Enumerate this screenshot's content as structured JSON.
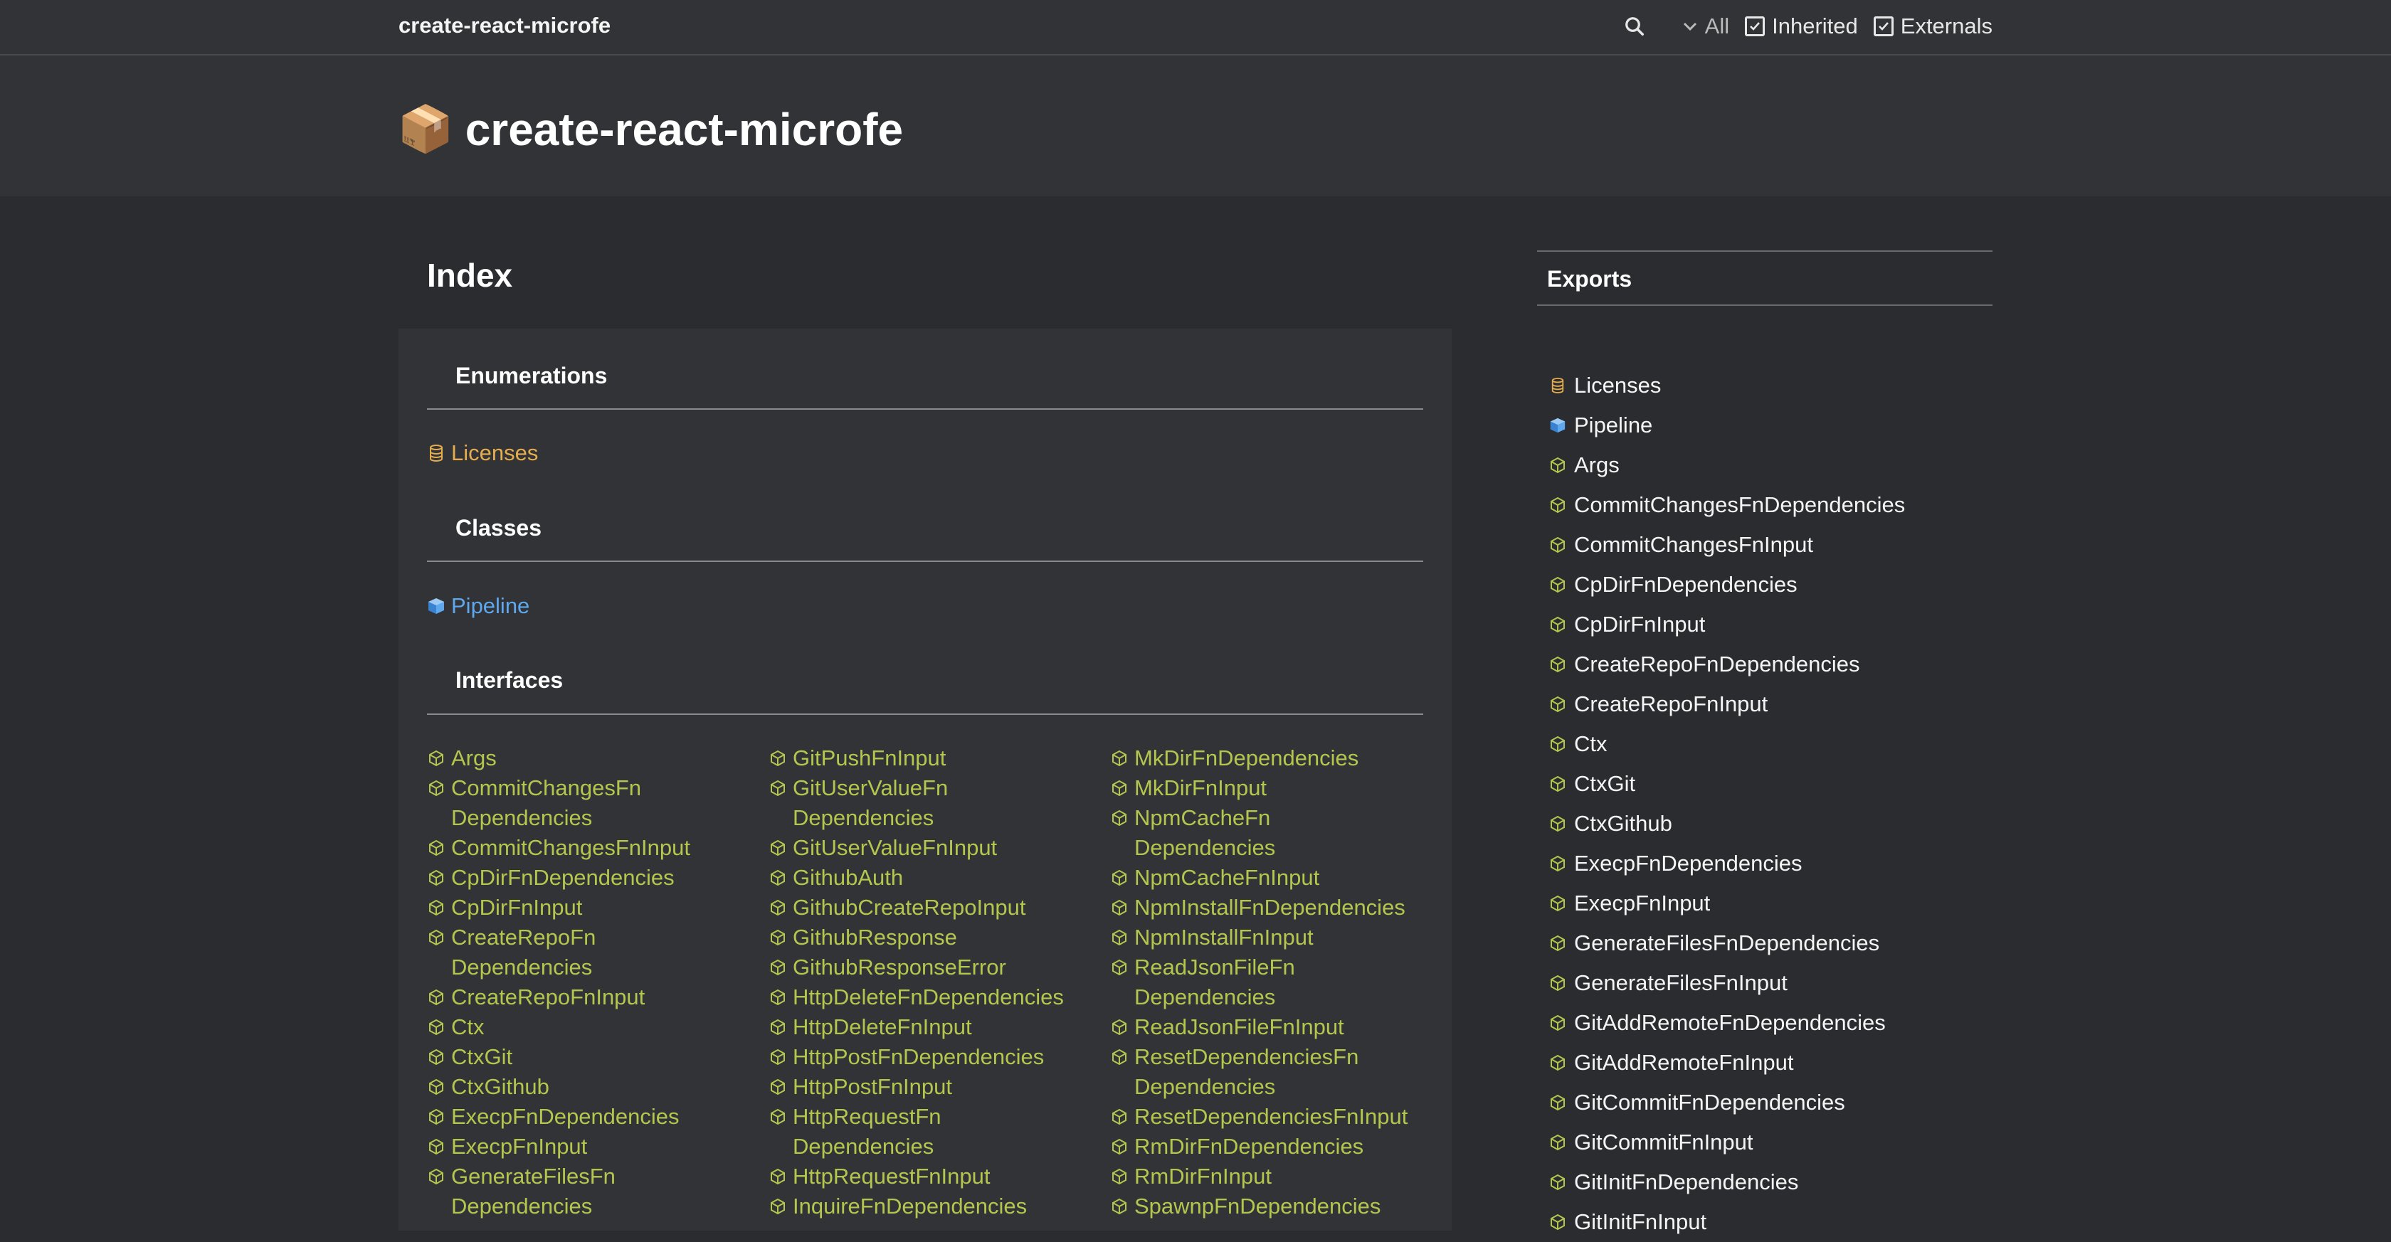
{
  "toolbar": {
    "brand": "create-react-microfe",
    "icons": {
      "search": "search-icon",
      "chevron": "chevron-down-icon",
      "check": "check-icon"
    },
    "filter_all": "All",
    "inherited": "Inherited",
    "externals": "Externals"
  },
  "title": {
    "emoji": "📦",
    "text": "create-react-microfe"
  },
  "index": {
    "heading": "Index",
    "sections": {
      "enumerations": "Enumerations",
      "classes": "Classes",
      "interfaces": "Interfaces"
    },
    "enumerations": [
      "Licenses"
    ],
    "classes": [
      "Pipeline"
    ],
    "interfaces_col1": [
      {
        "l1": "Args"
      },
      {
        "l1": "CommitChangesFn",
        "l2": "Dependencies"
      },
      {
        "l1": "CommitChangesFnInput"
      },
      {
        "l1": "CpDirFnDependencies"
      },
      {
        "l1": "CpDirFnInput"
      },
      {
        "l1": "CreateRepoFn",
        "l2": "Dependencies"
      },
      {
        "l1": "CreateRepoFnInput"
      },
      {
        "l1": "Ctx"
      },
      {
        "l1": "CtxGit"
      },
      {
        "l1": "CtxGithub"
      },
      {
        "l1": "ExecpFnDependencies"
      },
      {
        "l1": "ExecpFnInput"
      },
      {
        "l1": "GenerateFilesFn",
        "l2": "Dependencies"
      }
    ],
    "interfaces_col2": [
      {
        "l1": "GitPushFnInput"
      },
      {
        "l1": "GitUserValueFn",
        "l2": "Dependencies"
      },
      {
        "l1": "GitUserValueFnInput"
      },
      {
        "l1": "GithubAuth"
      },
      {
        "l1": "GithubCreateRepoInput"
      },
      {
        "l1": "GithubResponse"
      },
      {
        "l1": "GithubResponseError"
      },
      {
        "l1": "HttpDeleteFnDependencies"
      },
      {
        "l1": "HttpDeleteFnInput"
      },
      {
        "l1": "HttpPostFnDependencies"
      },
      {
        "l1": "HttpPostFnInput"
      },
      {
        "l1": "HttpRequestFn",
        "l2": "Dependencies"
      },
      {
        "l1": "HttpRequestFnInput"
      },
      {
        "l1": "InquireFnDependencies"
      }
    ],
    "interfaces_col3": [
      {
        "l1": "MkDirFnDependencies"
      },
      {
        "l1": "MkDirFnInput"
      },
      {
        "l1": "NpmCacheFn",
        "l2": "Dependencies"
      },
      {
        "l1": "NpmCacheFnInput"
      },
      {
        "l1": "NpmInstallFnDependencies"
      },
      {
        "l1": "NpmInstallFnInput"
      },
      {
        "l1": "ReadJsonFileFn",
        "l2": "Dependencies"
      },
      {
        "l1": "ReadJsonFileFnInput"
      },
      {
        "l1": "ResetDependenciesFn",
        "l2": "Dependencies"
      },
      {
        "l1": "ResetDependenciesFnInput"
      },
      {
        "l1": "RmDirFnDependencies"
      },
      {
        "l1": "RmDirFnInput"
      },
      {
        "l1": "SpawnpFnDependencies"
      }
    ]
  },
  "sidebar": {
    "label": "Exports",
    "items": [
      {
        "label": "Licenses",
        "kind": "enum"
      },
      {
        "label": "Pipeline",
        "kind": "class"
      },
      {
        "label": "Args",
        "kind": "interface"
      },
      {
        "label": "CommitChangesFnDependencies",
        "kind": "interface"
      },
      {
        "label": "CommitChangesFnInput",
        "kind": "interface"
      },
      {
        "label": "CpDirFnDependencies",
        "kind": "interface"
      },
      {
        "label": "CpDirFnInput",
        "kind": "interface"
      },
      {
        "label": "CreateRepoFnDependencies",
        "kind": "interface"
      },
      {
        "label": "CreateRepoFnInput",
        "kind": "interface"
      },
      {
        "label": "Ctx",
        "kind": "interface"
      },
      {
        "label": "CtxGit",
        "kind": "interface"
      },
      {
        "label": "CtxGithub",
        "kind": "interface"
      },
      {
        "label": "ExecpFnDependencies",
        "kind": "interface"
      },
      {
        "label": "ExecpFnInput",
        "kind": "interface"
      },
      {
        "label": "GenerateFilesFnDependencies",
        "kind": "interface"
      },
      {
        "label": "GenerateFilesFnInput",
        "kind": "interface"
      },
      {
        "label": "GitAddRemoteFnDependencies",
        "kind": "interface"
      },
      {
        "label": "GitAddRemoteFnInput",
        "kind": "interface"
      },
      {
        "label": "GitCommitFnDependencies",
        "kind": "interface"
      },
      {
        "label": "GitCommitFnInput",
        "kind": "interface"
      },
      {
        "label": "GitInitFnDependencies",
        "kind": "interface"
      },
      {
        "label": "GitInitFnInput",
        "kind": "interface"
      }
    ]
  },
  "colors": {
    "interface": "#b5c64f",
    "enum": "#e6ad4f",
    "class": "#5fa8ee",
    "background": "#2b2c30",
    "panel": "#323336"
  }
}
